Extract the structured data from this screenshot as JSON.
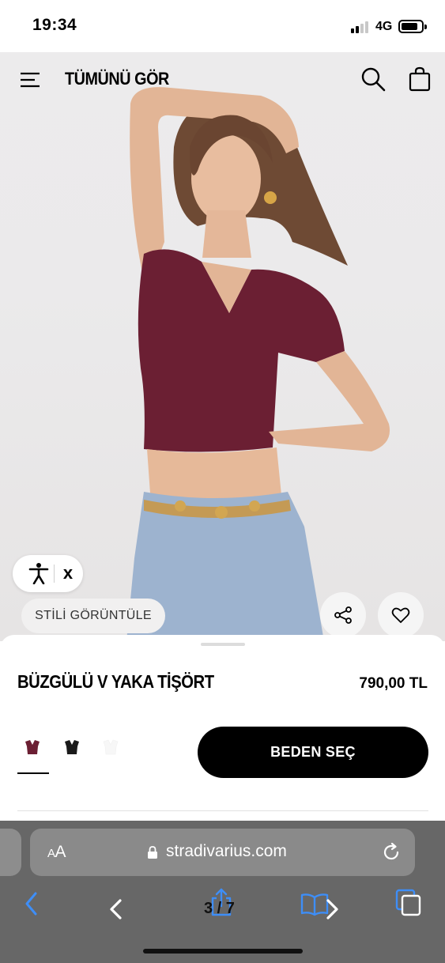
{
  "status_bar": {
    "time": "19:34",
    "network": "4G"
  },
  "nav": {
    "title": "TÜMÜNÜ GÖR"
  },
  "hero": {
    "style_button_label": "STİLİ GÖRÜNTÜLE",
    "accessibility_close": "x"
  },
  "product": {
    "name": "BÜZGÜLÜ V YAKA TİŞÖRT",
    "price": "790,00 TL",
    "size_button_label": "BEDEN SEÇ",
    "swatches": [
      {
        "color": "#6b1f33",
        "selected": true
      },
      {
        "color": "#1a1a1a",
        "selected": false
      },
      {
        "color": "#f7f7f7",
        "selected": false
      }
    ]
  },
  "browser": {
    "aa_label_small": "A",
    "aa_label": "A",
    "url": "stradivarius.com",
    "image_counter": "3 / 7"
  },
  "colors": {
    "product_top": "#6b1f33",
    "denim": "#9db3cf",
    "safari_bar": "#676767"
  }
}
